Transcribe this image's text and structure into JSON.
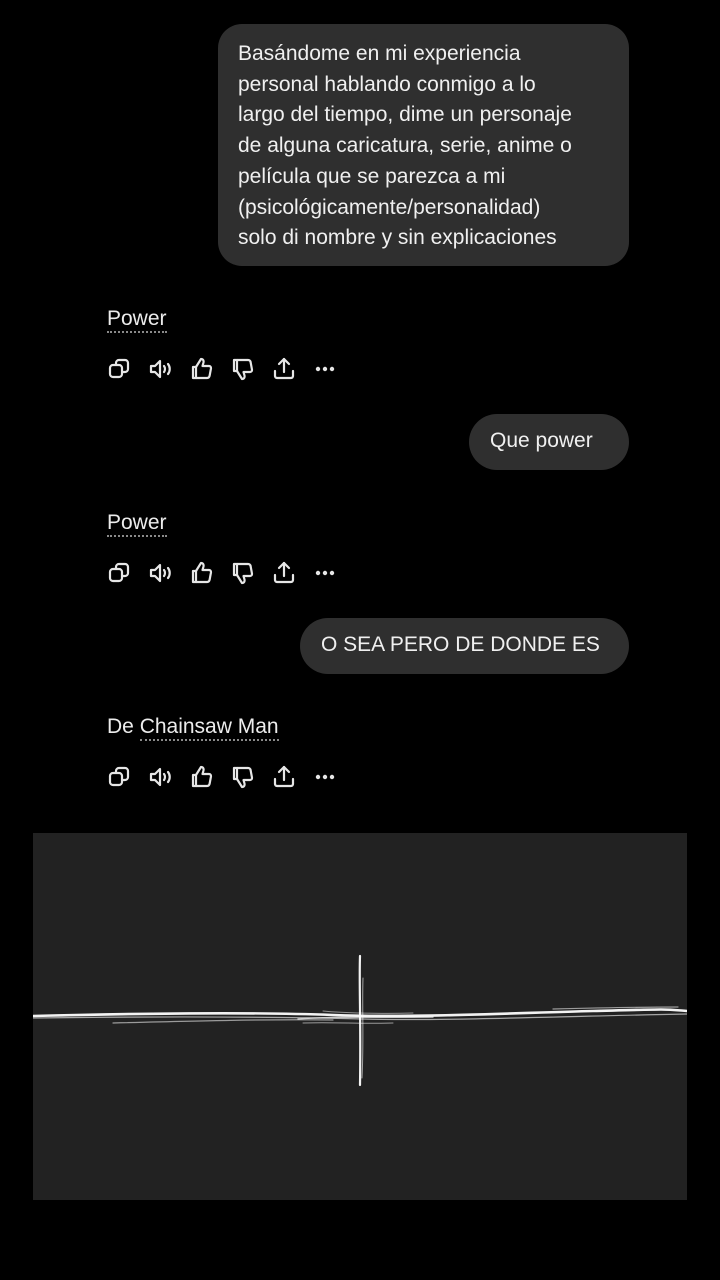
{
  "messages": [
    {
      "role": "user",
      "lines": [
        "Basándome en mi experiencia",
        "personal hablando conmigo a lo",
        "largo del tiempo, dime un personaje",
        "de alguna caricatura, serie, anime o",
        "película que se parezca a mi",
        "(psicológicamente/personalidad)",
        "solo di nombre y sin explicaciones"
      ]
    },
    {
      "role": "assistant",
      "text": "Power"
    },
    {
      "role": "user",
      "text": "Que power"
    },
    {
      "role": "assistant",
      "text": "Power"
    },
    {
      "role": "user",
      "text": "O SEA PERO DE DONDE ES"
    },
    {
      "role": "assistant",
      "prefix": "De ",
      "linked": "Chainsaw Man"
    }
  ],
  "actions": [
    "copy-icon",
    "speaker-icon",
    "thumbs-up-icon",
    "thumbs-down-icon",
    "share-icon",
    "more-icon"
  ],
  "colors": {
    "background": "#000000",
    "user_bubble": "#2f2f2f",
    "text": "#ececec",
    "sketch_background": "#222222",
    "sketch_stroke": "#ffffff"
  }
}
